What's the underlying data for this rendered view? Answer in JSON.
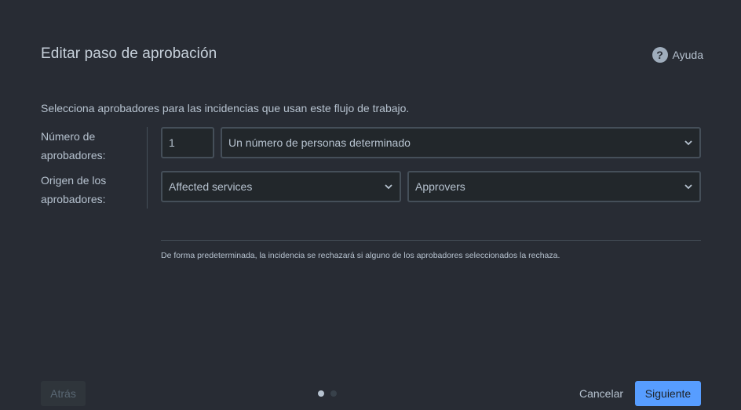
{
  "dialog": {
    "title": "Editar paso de aprobación",
    "help_label": "Ayuda",
    "help_icon": "question-circle-icon",
    "description": "Selecciona aprobadores para las incidencias que usan este flujo de trabajo."
  },
  "form": {
    "approver_count_label": "Número de aprobadores:",
    "approver_source_label": "Origen de los aprobadores:",
    "approver_count_value": "1",
    "count_mode_value": "Un número de personas determinado",
    "source_field_value": "Affected services",
    "source_role_value": "Approvers",
    "note": "De forma predeterminada, la incidencia se rechazará si alguno de los aprobadores seleccionados la rechaza."
  },
  "footer": {
    "back_label": "Atrás",
    "cancel_label": "Cancelar",
    "next_label": "Siguiente",
    "current_step": 1,
    "total_steps": 2
  },
  "colors": {
    "background": "#282c34",
    "primary": "#579dff",
    "field_border": "#454f59",
    "text": "#b6c2cf"
  }
}
